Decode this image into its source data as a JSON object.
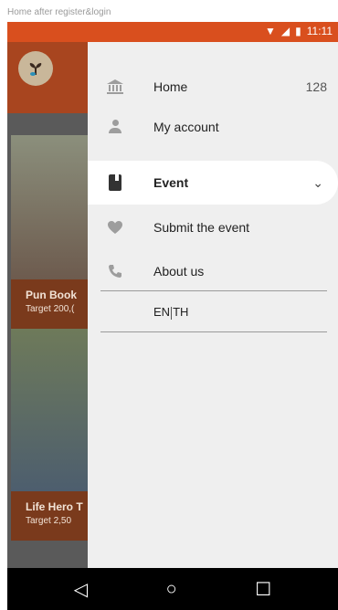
{
  "caption": "Home after register&login",
  "status_bar": {
    "time": "11:11"
  },
  "cards": [
    {
      "title": "Pun Book",
      "target": "Target 200,("
    },
    {
      "title": "Life Hero T",
      "target": "Target 2,50"
    }
  ],
  "drawer": {
    "items": [
      {
        "icon": "bank-icon",
        "label": "Home",
        "count": "128"
      },
      {
        "icon": "person-icon",
        "label": "My account"
      },
      {
        "icon": "book-icon",
        "label": "Event",
        "expand": "⌄"
      },
      {
        "icon": "heart-icon",
        "label": "Submit the event"
      },
      {
        "icon": "phone-icon",
        "label": "About us"
      }
    ],
    "language": {
      "en": "EN",
      "th": "TH"
    }
  },
  "navbar": {
    "back": "◁",
    "home": "○",
    "recents": "☐"
  }
}
